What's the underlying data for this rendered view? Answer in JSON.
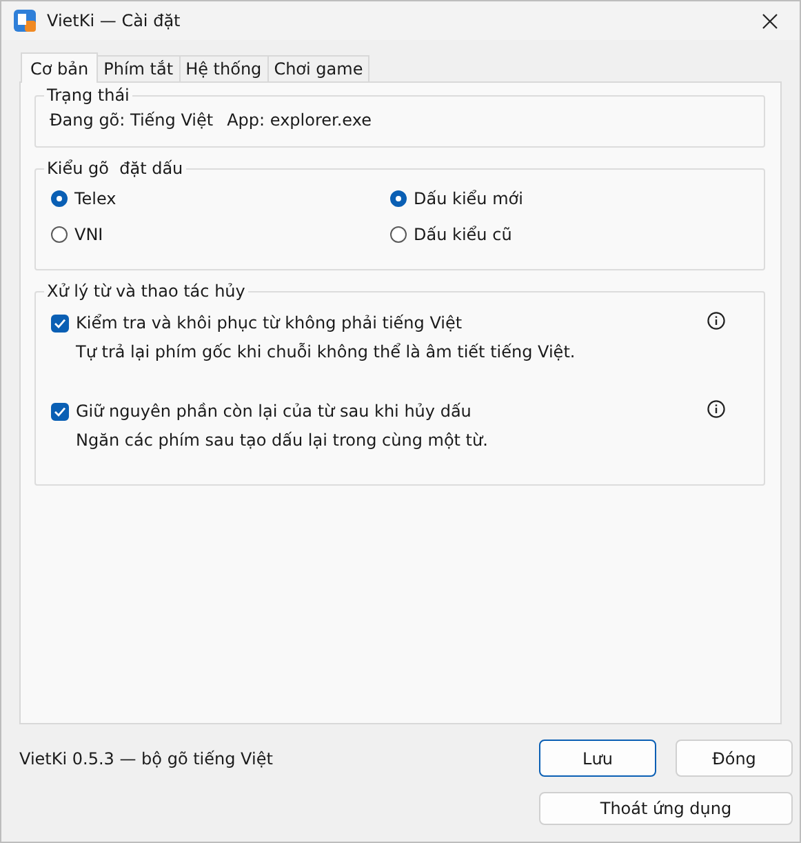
{
  "window": {
    "title": "VietKi — Cài đặt"
  },
  "tabs": [
    {
      "label": "Cơ bản",
      "selected": true
    },
    {
      "label": "Phím tắt",
      "selected": false
    },
    {
      "label": "Hệ thống",
      "selected": false
    },
    {
      "label": "Chơi game",
      "selected": false
    }
  ],
  "status_group": {
    "title": "Trạng thái",
    "typing": "Đang gõ: Tiếng Việt",
    "app": "App: explorer.exe"
  },
  "input_group": {
    "title": "Kiểu gõ  đặt dấu",
    "methods": [
      {
        "label": "Telex",
        "selected": true
      },
      {
        "label": "VNI",
        "selected": false
      }
    ],
    "tone_styles": [
      {
        "label": "Dấu kiểu mới",
        "selected": true
      },
      {
        "label": "Dấu kiểu cũ",
        "selected": false
      }
    ]
  },
  "word_group": {
    "title": "Xử lý từ và thao tác hủy",
    "options": [
      {
        "label": "Kiểm tra và khôi phục từ không phải tiếng Việt",
        "description": "Tự trả lại phím gốc khi chuỗi không thể là âm tiết tiếng Việt.",
        "checked": true
      },
      {
        "label": "Giữ nguyên phần còn lại của từ sau khi hủy dấu",
        "description": "Ngăn các phím sau tạo dấu lại trong cùng một từ.",
        "checked": true
      }
    ]
  },
  "footer": {
    "version": "VietKi 0.5.3 — bộ gõ tiếng Việt",
    "buttons": [
      {
        "label": "Lưu",
        "kind": "default"
      },
      {
        "label": "Đóng",
        "kind": "normal"
      },
      {
        "label": "Thoát ứng dụng",
        "kind": "normal"
      }
    ]
  }
}
